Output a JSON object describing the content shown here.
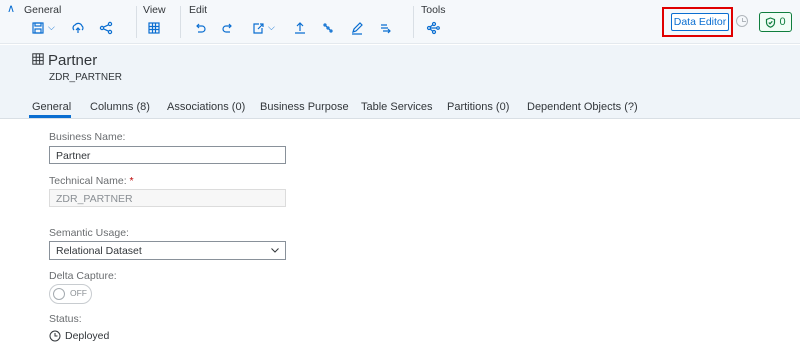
{
  "toolbar": {
    "groups": [
      {
        "label": "General"
      },
      {
        "label": "View"
      },
      {
        "label": "Edit"
      },
      {
        "label": "Tools"
      }
    ],
    "data_editor_label": "Data Editor",
    "validation_count": "0"
  },
  "object": {
    "title": "Partner",
    "technical_subtitle": "ZDR_PARTNER"
  },
  "tabs": [
    {
      "label": "General"
    },
    {
      "label": "Columns (8)"
    },
    {
      "label": "Associations (0)"
    },
    {
      "label": "Business Purpose"
    },
    {
      "label": "Table Services"
    },
    {
      "label": "Partitions (0)"
    },
    {
      "label": "Dependent Objects (?)"
    }
  ],
  "form": {
    "business_name_label": "Business Name:",
    "business_name_value": "Partner",
    "technical_name_label": "Technical Name:",
    "technical_name_required": "*",
    "technical_name_value": "ZDR_PARTNER",
    "semantic_usage_label": "Semantic Usage:",
    "semantic_usage_value": "Relational Dataset",
    "delta_capture_label": "Delta Capture:",
    "delta_capture_state": "OFF",
    "status_label": "Status:",
    "status_value": "Deployed"
  },
  "colors": {
    "accent": "#0a6ed1",
    "highlight": "#e00000",
    "success": "#107e3e"
  }
}
